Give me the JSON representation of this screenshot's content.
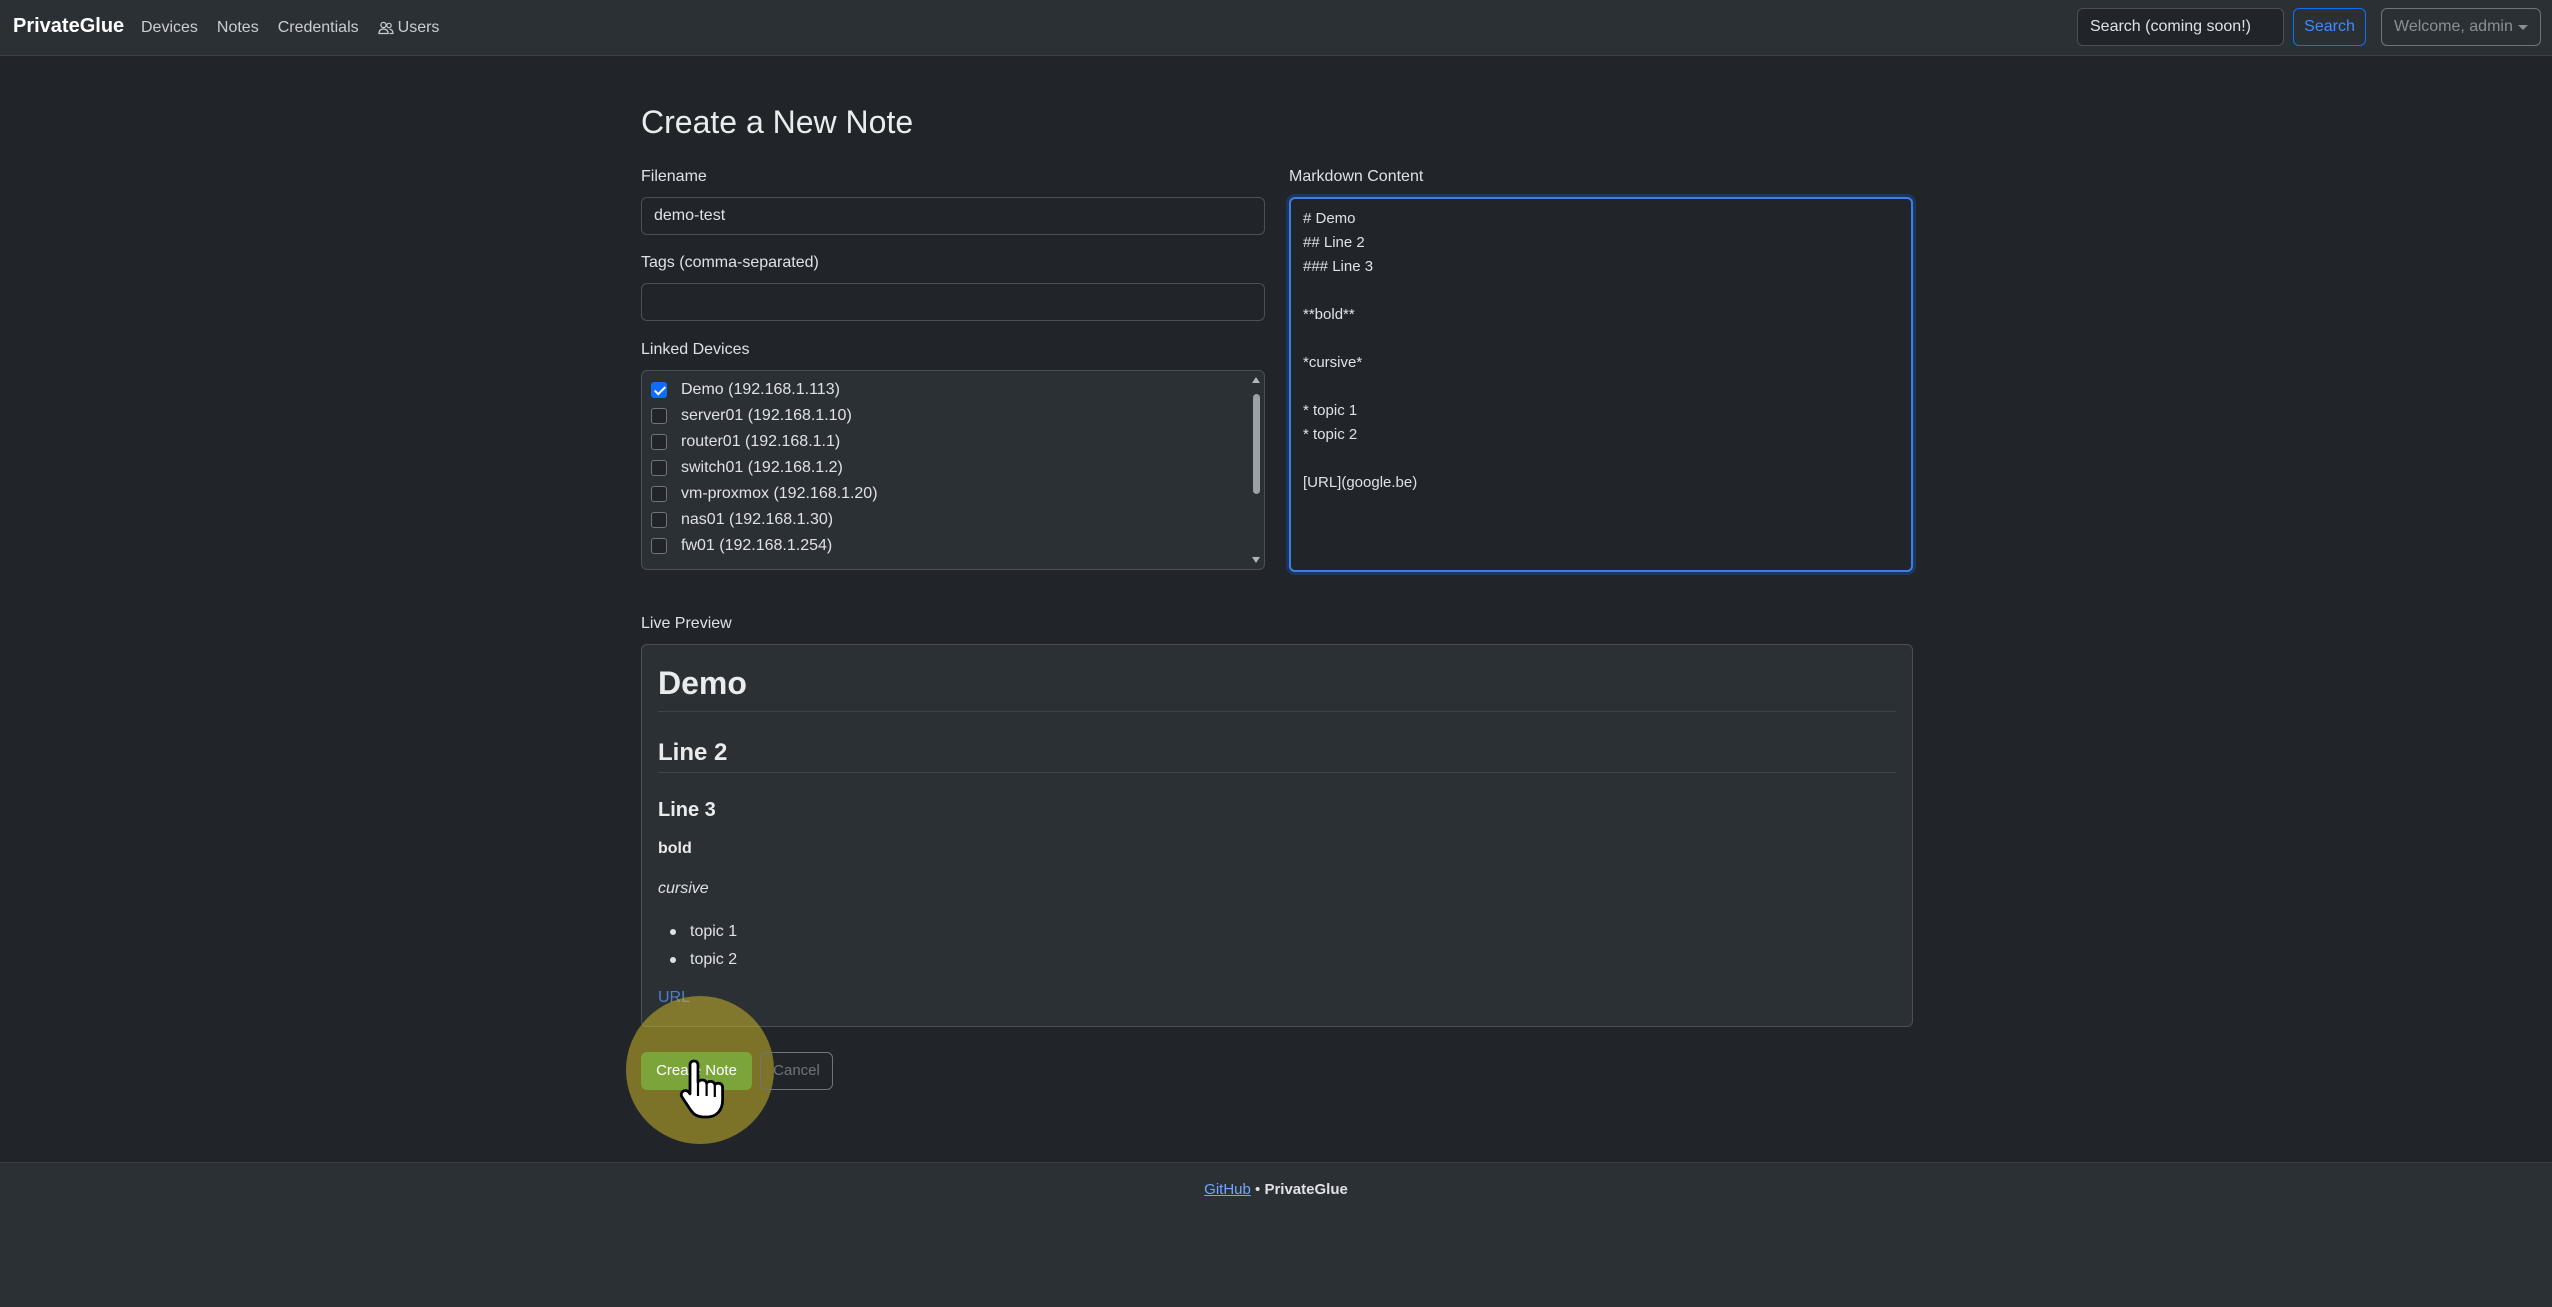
{
  "navbar": {
    "brand": "PrivateGlue",
    "links": [
      "Devices",
      "Notes",
      "Credentials",
      "Users"
    ],
    "search_placeholder": "Search (coming soon!)",
    "search_button": "Search",
    "user_menu": "Welcome, admin"
  },
  "page": {
    "title": "Create a New Note"
  },
  "form": {
    "filename_label": "Filename",
    "filename_value": "demo-test",
    "tags_label": "Tags (comma-separated)",
    "tags_value": "",
    "devices_label": "Linked Devices",
    "devices": [
      {
        "label": "Demo (192.168.1.113)",
        "checked": true
      },
      {
        "label": "server01 (192.168.1.10)",
        "checked": false
      },
      {
        "label": "router01 (192.168.1.1)",
        "checked": false
      },
      {
        "label": "switch01 (192.168.1.2)",
        "checked": false
      },
      {
        "label": "vm-proxmox (192.168.1.20)",
        "checked": false
      },
      {
        "label": "nas01 (192.168.1.30)",
        "checked": false
      },
      {
        "label": "fw01 (192.168.1.254)",
        "checked": false
      }
    ],
    "content_label": "Markdown Content",
    "content_value": "# Demo\n## Line 2\n### Line 3\n\n**bold**\n\n*cursive*\n\n* topic 1\n* topic 2\n\n[URL](google.be)"
  },
  "preview": {
    "label": "Live Preview",
    "h1": "Demo",
    "h2": "Line 2",
    "h3": "Line 3",
    "bold": "bold",
    "italic": "cursive",
    "list": [
      "topic 1",
      "topic 2"
    ],
    "link": "URL"
  },
  "actions": {
    "create": "Create Note",
    "cancel": "Cancel"
  },
  "footer": {
    "link": "GitHub",
    "separator": " • ",
    "name": "PrivateGlue"
  }
}
